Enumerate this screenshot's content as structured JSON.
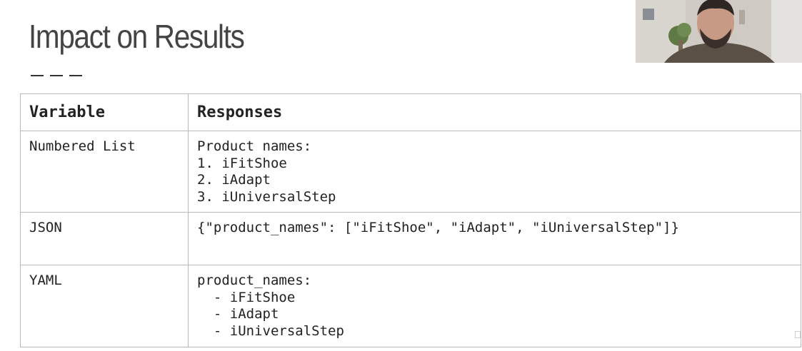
{
  "slide": {
    "title": "Impact on Results"
  },
  "table": {
    "headers": [
      "Variable",
      "Responses"
    ],
    "rows": [
      {
        "variable": "Numbered List",
        "response_lines": [
          "Product names:",
          "1. iFitShoe",
          "2. iAdapt",
          "3. iUniversalStep"
        ]
      },
      {
        "variable": "JSON",
        "response_lines": [
          "{\"product_names\": [\"iFitShoe\", \"iAdapt\", \"iUniversalStep\"]}"
        ]
      },
      {
        "variable": "YAML",
        "response_lines": [
          "product_names:",
          "  - iFitShoe",
          "  - iAdapt",
          "  - iUniversalStep"
        ]
      }
    ]
  },
  "colors": {
    "title": "#444444",
    "table_border": "#b8b8b8",
    "text": "#222222",
    "background": "#ffffff"
  }
}
